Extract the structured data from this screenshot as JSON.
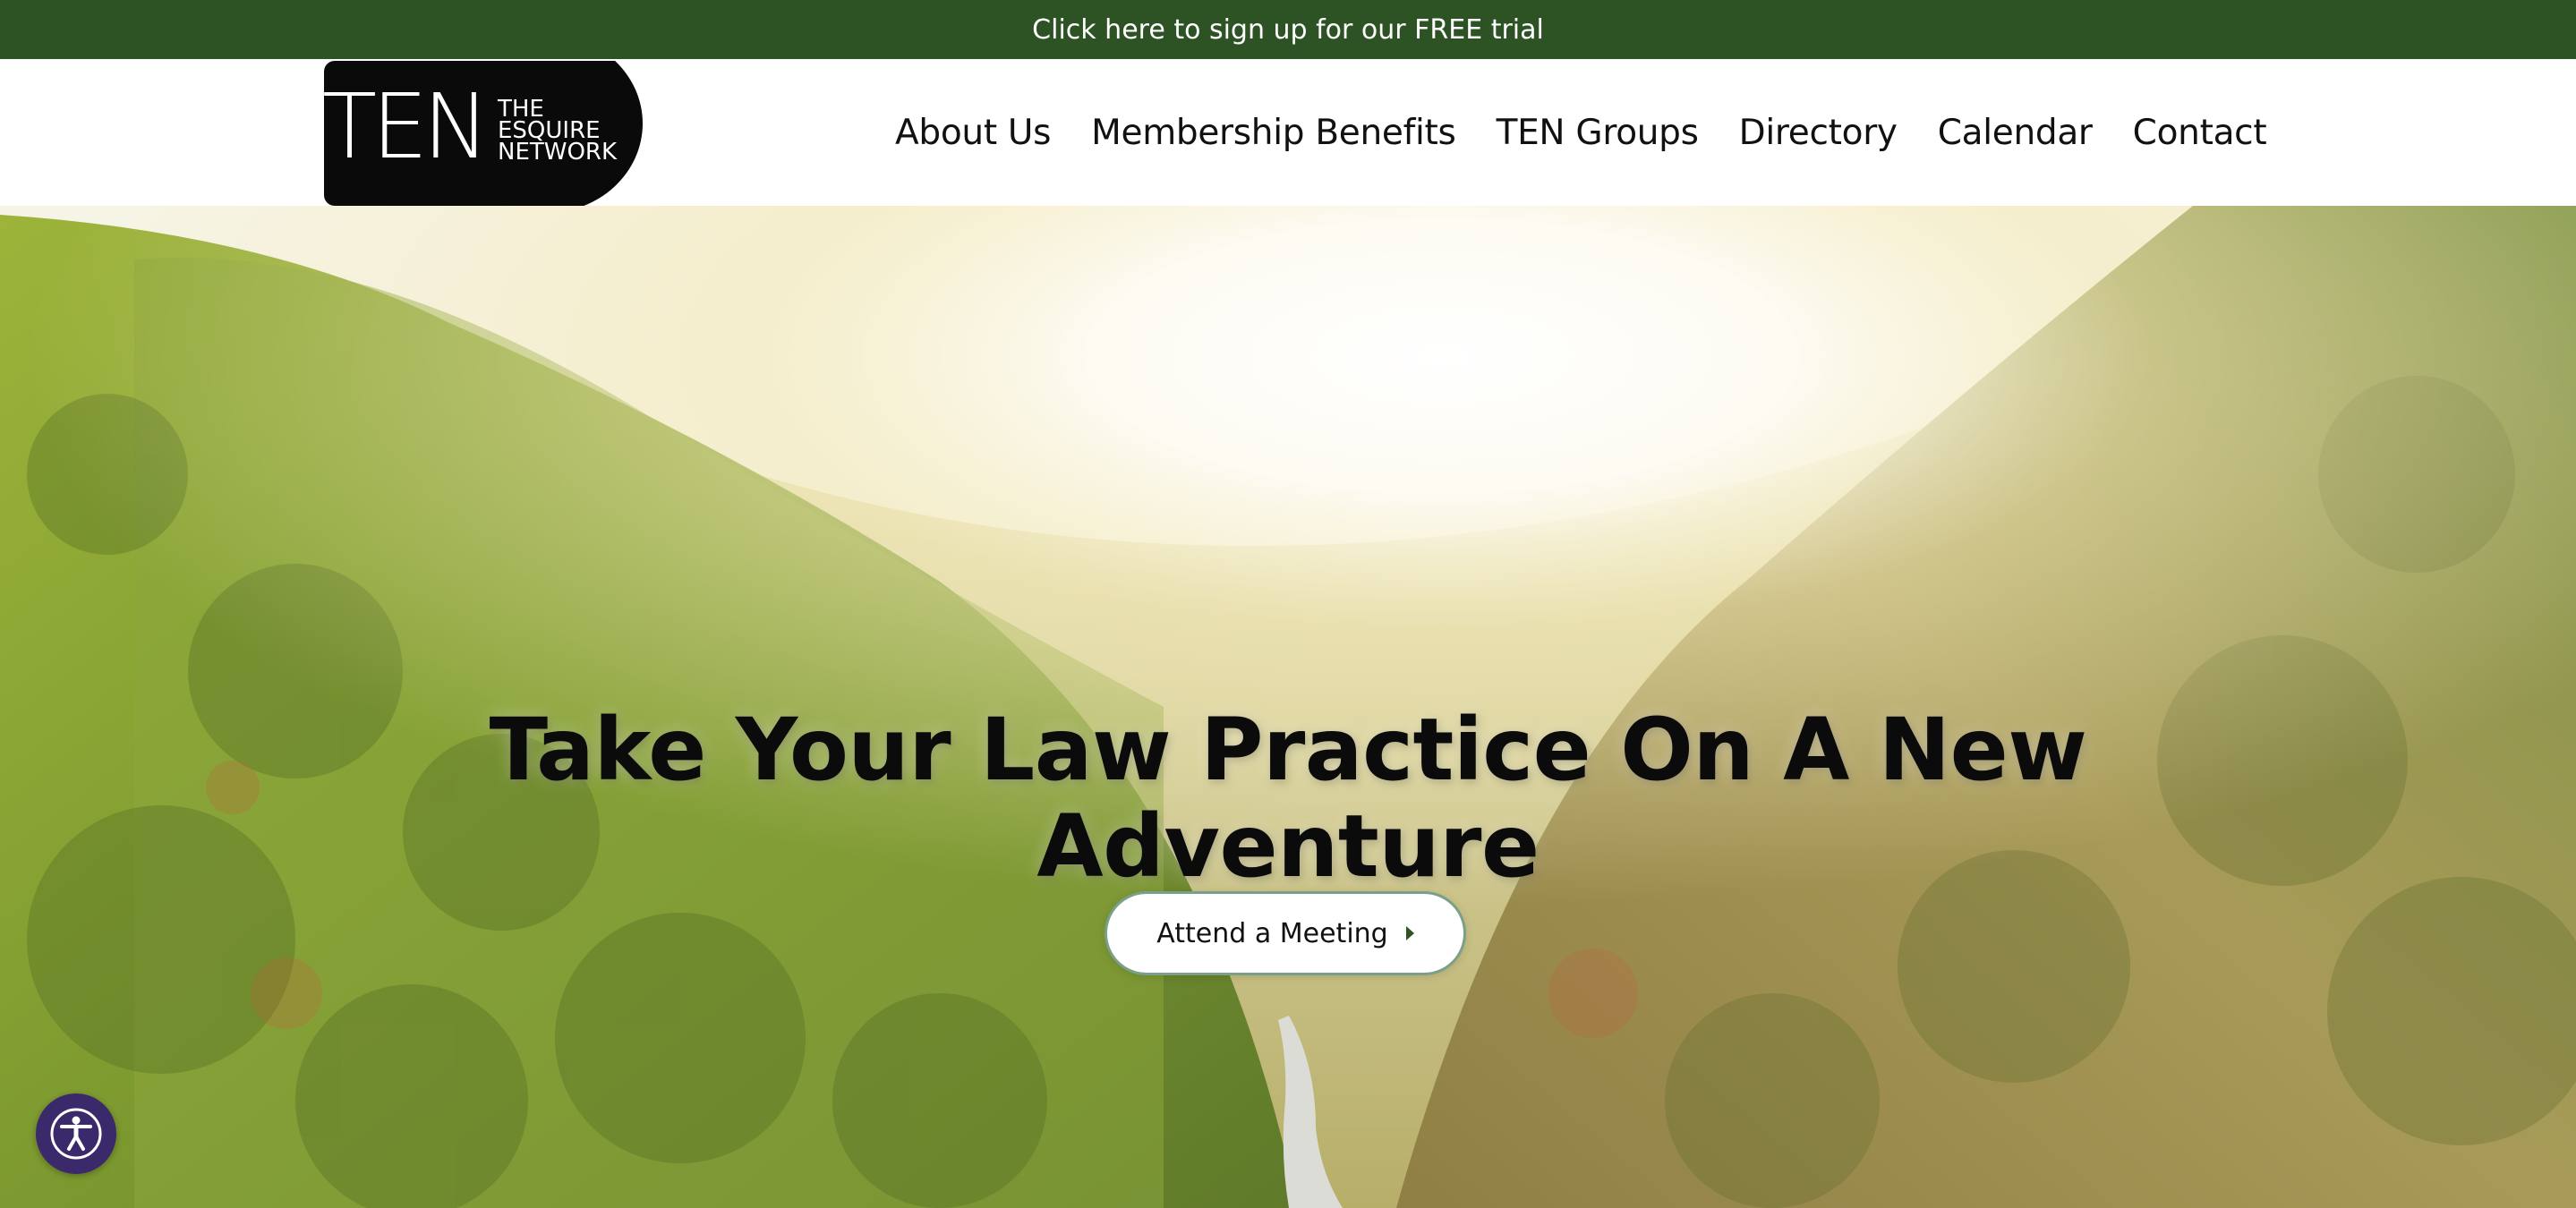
{
  "promo": {
    "text": "Click here to sign up for our FREE trial"
  },
  "header": {
    "logo": {
      "line1": "TEN",
      "line2": "THE",
      "line3": "ESQUIRE",
      "line4": "NETWORK",
      "icon": "ten-esquire-network-logo"
    },
    "nav": [
      {
        "label": "About Us"
      },
      {
        "label": "Membership Benefits"
      },
      {
        "label": "TEN Groups"
      },
      {
        "label": "Directory"
      },
      {
        "label": "Calendar"
      },
      {
        "label": "Contact"
      }
    ]
  },
  "hero": {
    "title": "Take Your Law Practice On A New Adventure",
    "cta_label": "Attend a Meeting",
    "cta_icon": "caret-right-icon",
    "background": "forest-valley-road-sunlight"
  },
  "accessibility": {
    "icon": "accessibility-icon"
  },
  "colors": {
    "brand_green": "#2d5224",
    "accessibility_purple": "#3b2a6b"
  }
}
